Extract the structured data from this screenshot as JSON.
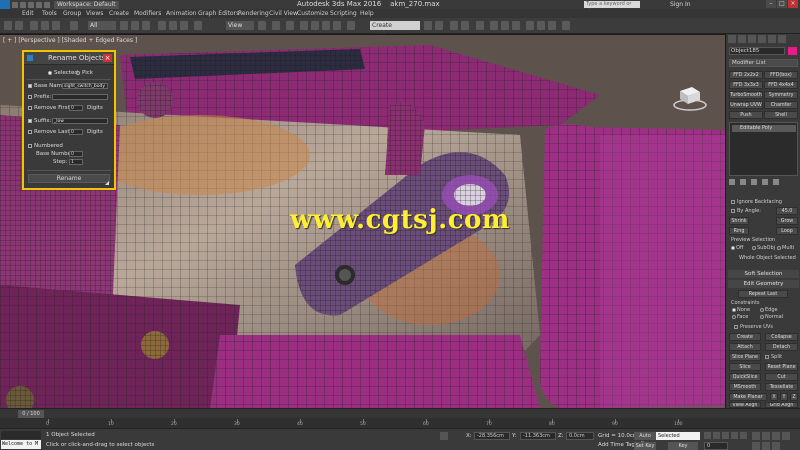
{
  "titlebar": {
    "workspace": "Workspace: Default",
    "app_title": "Autodesk 3ds Max 2016",
    "file_name": "akm_270.max",
    "search_placeholder": "Type a keyword or phrase",
    "sign_in": "Sign In"
  },
  "menu": [
    "Edit",
    "Tools",
    "Group",
    "Views",
    "Create",
    "Modifiers",
    "Animation",
    "Graph Editors",
    "Rendering",
    "Civil View",
    "Customize",
    "Scripting",
    "Help"
  ],
  "toolbar": {
    "filter": "All",
    "ref_coord": "View",
    "sel_set": "Create Selection Se"
  },
  "viewport": {
    "label": "[ + ] [Perspective ] [Shaded + Edged Faces ]",
    "watermark": "www.cgtsj.com"
  },
  "rename_dialog": {
    "title": "Rename Objects",
    "selected": "Selected",
    "pick": "Pick",
    "base_name_label": "Base Name:",
    "base_name_value": "sight_switch_body",
    "prefix_label": "Prefix:",
    "remove_first_label": "Remove First:",
    "remove_first_value": "0",
    "digits1": "Digits",
    "suffix_label": "Suffix:",
    "suffix_value": "_low",
    "remove_last_label": "Remove Last:",
    "remove_last_value": "0",
    "digits2": "Digits",
    "numbered_label": "Numbered",
    "base_number_label": "Base Number:",
    "base_number_value": "0",
    "step_label": "Step:",
    "step_value": "1",
    "rename_button": "Rename"
  },
  "command_panel": {
    "object_name": "Object185",
    "modifier_list": "Modifier List",
    "modifier_buttons": [
      "FFD 2x2x2",
      "FFD(box)",
      "FFD 3x3x3",
      "FFD 4x4x4",
      "TurboSmooth",
      "Symmetry",
      "Unwrap UVW",
      "Chamfer",
      "Push",
      "Shell"
    ],
    "stack_item": "Editable Poly",
    "ignore_backfacing": "Ignore Backfacing",
    "by_angle": "By Angle:",
    "by_angle_value": "45.0",
    "shrink": "Shrink",
    "grow": "Grow",
    "ring": "Ring",
    "loop": "Loop",
    "preview_selection": "Preview Selection",
    "off": "Off",
    "subobj": "SubObj",
    "multi": "Multi",
    "whole_object": "Whole Object Selected",
    "soft_selection": "Soft Selection",
    "edit_geometry": "Edit Geometry",
    "repeat_last": "Repeat Last",
    "constraints": "Constraints",
    "none": "None",
    "edge": "Edge",
    "face": "Face",
    "normal": "Normal",
    "preserve_uvs": "Preserve UVs",
    "create": "Create",
    "collapse": "Collapse",
    "attach": "Attach",
    "detach": "Detach",
    "slice_plane": "Slice Plane",
    "split": "Split",
    "slice": "Slice",
    "reset_plane": "Reset Plane",
    "quickslice": "QuickSlice",
    "cut": "Cut",
    "msmooth": "MSmooth",
    "tessellate": "Tessellate",
    "make_planar": "Make Planar",
    "x": "X",
    "y": "Y",
    "z": "Z",
    "view_align": "View Align",
    "grid_align": "Grid Align",
    "relax": "Relax"
  },
  "timeline": {
    "frame": "0 / 100",
    "ticks": [
      "0",
      "10",
      "20",
      "30",
      "40",
      "50",
      "60",
      "70",
      "80",
      "90",
      "100"
    ]
  },
  "status": {
    "maxscript": "Welcome to M",
    "objects_selected": "1 Object Selected",
    "prompt": "Click or click-and-drag to select objects",
    "x_label": "X:",
    "x_value": "-28.356cm",
    "y_label": "Y:",
    "y_value": "-11.363cm",
    "z_label": "Z:",
    "z_value": "0.0cm",
    "grid": "Grid = 10.0cm",
    "add_time_tag": "Add Time Tag",
    "auto_key": "Auto Key",
    "selected": "Selected",
    "set_key": "Set Key",
    "key_filters": "Key Filters...",
    "frame_value": "0"
  }
}
